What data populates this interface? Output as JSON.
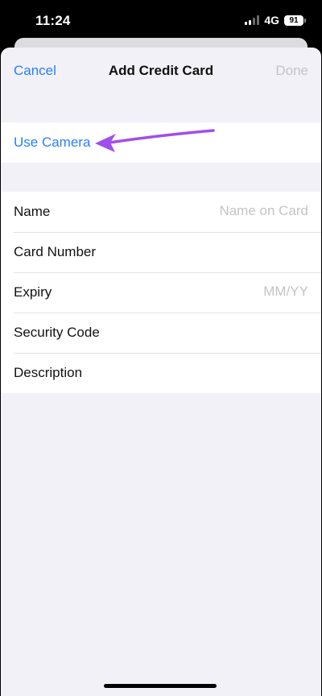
{
  "status_bar": {
    "time": "11:24",
    "network": "4G",
    "battery": "91",
    "signal_icon": "cellular-signal-icon"
  },
  "nav": {
    "cancel_label": "Cancel",
    "title": "Add Credit Card",
    "done_label": "Done"
  },
  "camera": {
    "label": "Use Camera"
  },
  "annotation": {
    "arrow_color": "#a04fea"
  },
  "form": {
    "rows": [
      {
        "label": "Name",
        "placeholder": "Name on Card"
      },
      {
        "label": "Card Number",
        "placeholder": ""
      },
      {
        "label": "Expiry",
        "placeholder": "MM/YY"
      },
      {
        "label": "Security Code",
        "placeholder": ""
      },
      {
        "label": "Description",
        "placeholder": ""
      }
    ]
  },
  "colors": {
    "accent": "#2a7ff5",
    "disabled": "#c3c3c7",
    "background": "#f2f1f7"
  }
}
